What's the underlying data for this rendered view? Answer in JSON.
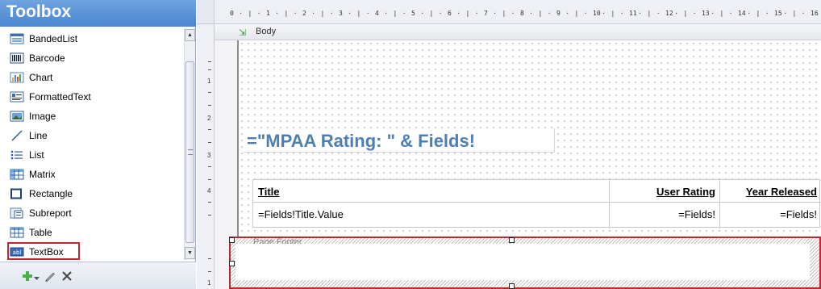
{
  "toolbox": {
    "title": "Toolbox",
    "items": [
      {
        "label": "BandedList",
        "icon": "banded-list-icon"
      },
      {
        "label": "Barcode",
        "icon": "barcode-icon"
      },
      {
        "label": "Chart",
        "icon": "chart-icon"
      },
      {
        "label": "FormattedText",
        "icon": "formatted-text-icon"
      },
      {
        "label": "Image",
        "icon": "image-icon"
      },
      {
        "label": "Line",
        "icon": "line-icon"
      },
      {
        "label": "List",
        "icon": "list-icon"
      },
      {
        "label": "Matrix",
        "icon": "matrix-icon"
      },
      {
        "label": "Rectangle",
        "icon": "rectangle-icon"
      },
      {
        "label": "Subreport",
        "icon": "subreport-icon"
      },
      {
        "label": "Table",
        "icon": "table-icon"
      },
      {
        "label": "TextBox",
        "icon": "textbox-icon",
        "selected": true
      }
    ],
    "bottom_icons": [
      "add-icon",
      "dropdown-arrow-icon",
      "pencil-icon",
      "delete-icon"
    ]
  },
  "ruler": {
    "horizontal_numbers": [
      "0",
      "1",
      "2",
      "3",
      "4",
      "5",
      "6",
      "7",
      "8",
      "9",
      "10",
      "11",
      "12",
      "13",
      "14",
      "15",
      "16"
    ],
    "vertical_numbers": [
      "1",
      "2",
      "3",
      "4",
      "1"
    ]
  },
  "design": {
    "body_band": {
      "label": "Body",
      "icon": "section-arrow-icon"
    },
    "mpaa_expression": "=\"MPAA Rating: \" & Fields!",
    "table": {
      "headers": [
        "Title",
        "User Rating",
        "Year Released"
      ],
      "row": [
        "=Fields!Title.Value",
        "=Fields!",
        "=Fields!"
      ]
    },
    "footer_band": {
      "label": "Page Footer"
    }
  },
  "colors": {
    "toolbox_title_bg": "#4a86d0",
    "selection_outline": "#c0282d",
    "expression_text": "#4d7fb3"
  }
}
